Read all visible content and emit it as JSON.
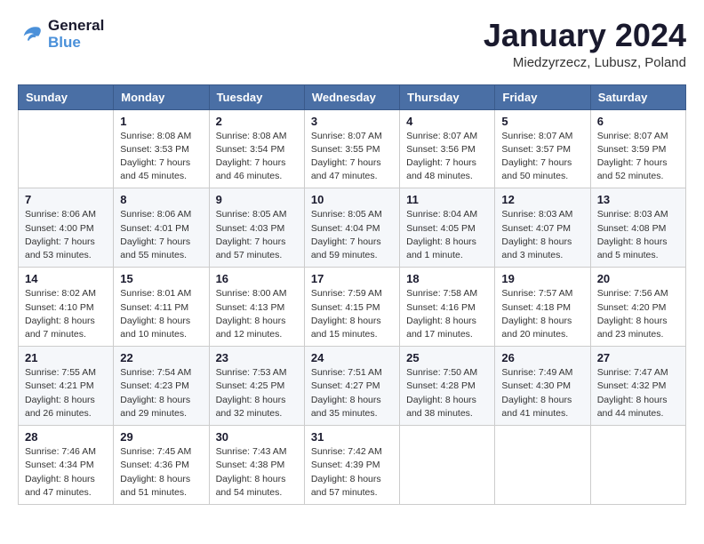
{
  "header": {
    "logo_line1": "General",
    "logo_line2": "Blue",
    "month_year": "January 2024",
    "location": "Miedzyrzecz, Lubusz, Poland"
  },
  "weekdays": [
    "Sunday",
    "Monday",
    "Tuesday",
    "Wednesday",
    "Thursday",
    "Friday",
    "Saturday"
  ],
  "weeks": [
    [
      {
        "day": "",
        "info": ""
      },
      {
        "day": "1",
        "info": "Sunrise: 8:08 AM\nSunset: 3:53 PM\nDaylight: 7 hours\nand 45 minutes."
      },
      {
        "day": "2",
        "info": "Sunrise: 8:08 AM\nSunset: 3:54 PM\nDaylight: 7 hours\nand 46 minutes."
      },
      {
        "day": "3",
        "info": "Sunrise: 8:07 AM\nSunset: 3:55 PM\nDaylight: 7 hours\nand 47 minutes."
      },
      {
        "day": "4",
        "info": "Sunrise: 8:07 AM\nSunset: 3:56 PM\nDaylight: 7 hours\nand 48 minutes."
      },
      {
        "day": "5",
        "info": "Sunrise: 8:07 AM\nSunset: 3:57 PM\nDaylight: 7 hours\nand 50 minutes."
      },
      {
        "day": "6",
        "info": "Sunrise: 8:07 AM\nSunset: 3:59 PM\nDaylight: 7 hours\nand 52 minutes."
      }
    ],
    [
      {
        "day": "7",
        "info": "Sunrise: 8:06 AM\nSunset: 4:00 PM\nDaylight: 7 hours\nand 53 minutes."
      },
      {
        "day": "8",
        "info": "Sunrise: 8:06 AM\nSunset: 4:01 PM\nDaylight: 7 hours\nand 55 minutes."
      },
      {
        "day": "9",
        "info": "Sunrise: 8:05 AM\nSunset: 4:03 PM\nDaylight: 7 hours\nand 57 minutes."
      },
      {
        "day": "10",
        "info": "Sunrise: 8:05 AM\nSunset: 4:04 PM\nDaylight: 7 hours\nand 59 minutes."
      },
      {
        "day": "11",
        "info": "Sunrise: 8:04 AM\nSunset: 4:05 PM\nDaylight: 8 hours\nand 1 minute."
      },
      {
        "day": "12",
        "info": "Sunrise: 8:03 AM\nSunset: 4:07 PM\nDaylight: 8 hours\nand 3 minutes."
      },
      {
        "day": "13",
        "info": "Sunrise: 8:03 AM\nSunset: 4:08 PM\nDaylight: 8 hours\nand 5 minutes."
      }
    ],
    [
      {
        "day": "14",
        "info": "Sunrise: 8:02 AM\nSunset: 4:10 PM\nDaylight: 8 hours\nand 7 minutes."
      },
      {
        "day": "15",
        "info": "Sunrise: 8:01 AM\nSunset: 4:11 PM\nDaylight: 8 hours\nand 10 minutes."
      },
      {
        "day": "16",
        "info": "Sunrise: 8:00 AM\nSunset: 4:13 PM\nDaylight: 8 hours\nand 12 minutes."
      },
      {
        "day": "17",
        "info": "Sunrise: 7:59 AM\nSunset: 4:15 PM\nDaylight: 8 hours\nand 15 minutes."
      },
      {
        "day": "18",
        "info": "Sunrise: 7:58 AM\nSunset: 4:16 PM\nDaylight: 8 hours\nand 17 minutes."
      },
      {
        "day": "19",
        "info": "Sunrise: 7:57 AM\nSunset: 4:18 PM\nDaylight: 8 hours\nand 20 minutes."
      },
      {
        "day": "20",
        "info": "Sunrise: 7:56 AM\nSunset: 4:20 PM\nDaylight: 8 hours\nand 23 minutes."
      }
    ],
    [
      {
        "day": "21",
        "info": "Sunrise: 7:55 AM\nSunset: 4:21 PM\nDaylight: 8 hours\nand 26 minutes."
      },
      {
        "day": "22",
        "info": "Sunrise: 7:54 AM\nSunset: 4:23 PM\nDaylight: 8 hours\nand 29 minutes."
      },
      {
        "day": "23",
        "info": "Sunrise: 7:53 AM\nSunset: 4:25 PM\nDaylight: 8 hours\nand 32 minutes."
      },
      {
        "day": "24",
        "info": "Sunrise: 7:51 AM\nSunset: 4:27 PM\nDaylight: 8 hours\nand 35 minutes."
      },
      {
        "day": "25",
        "info": "Sunrise: 7:50 AM\nSunset: 4:28 PM\nDaylight: 8 hours\nand 38 minutes."
      },
      {
        "day": "26",
        "info": "Sunrise: 7:49 AM\nSunset: 4:30 PM\nDaylight: 8 hours\nand 41 minutes."
      },
      {
        "day": "27",
        "info": "Sunrise: 7:47 AM\nSunset: 4:32 PM\nDaylight: 8 hours\nand 44 minutes."
      }
    ],
    [
      {
        "day": "28",
        "info": "Sunrise: 7:46 AM\nSunset: 4:34 PM\nDaylight: 8 hours\nand 47 minutes."
      },
      {
        "day": "29",
        "info": "Sunrise: 7:45 AM\nSunset: 4:36 PM\nDaylight: 8 hours\nand 51 minutes."
      },
      {
        "day": "30",
        "info": "Sunrise: 7:43 AM\nSunset: 4:38 PM\nDaylight: 8 hours\nand 54 minutes."
      },
      {
        "day": "31",
        "info": "Sunrise: 7:42 AM\nSunset: 4:39 PM\nDaylight: 8 hours\nand 57 minutes."
      },
      {
        "day": "",
        "info": ""
      },
      {
        "day": "",
        "info": ""
      },
      {
        "day": "",
        "info": ""
      }
    ]
  ]
}
